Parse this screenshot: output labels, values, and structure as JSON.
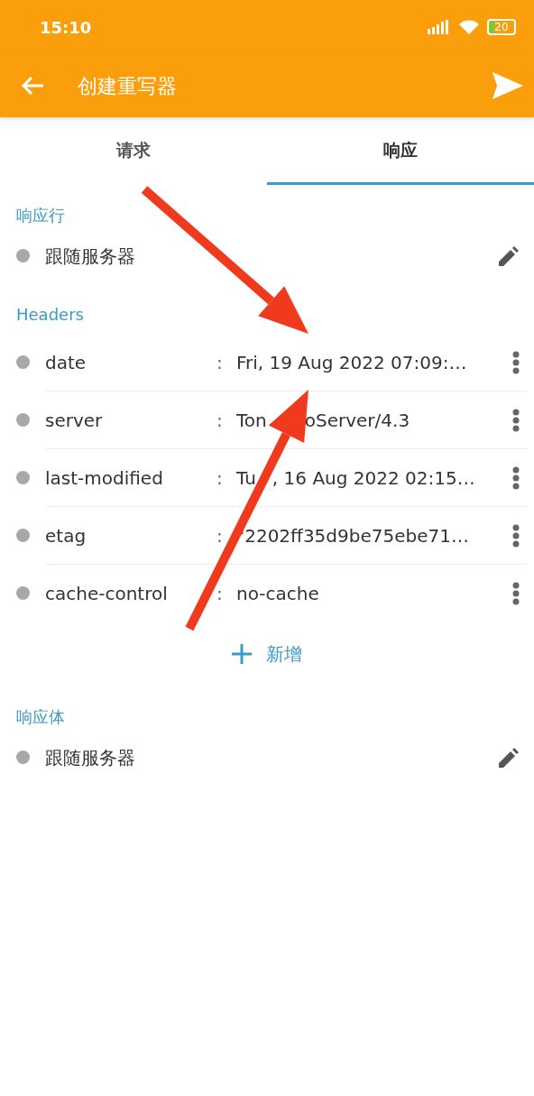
{
  "status_bar": {
    "time": "15:10",
    "battery": "20"
  },
  "app_bar": {
    "title": "创建重写器"
  },
  "tabs": [
    {
      "label": "请求",
      "selected": false
    },
    {
      "label": "响应",
      "selected": true
    }
  ],
  "response_line": {
    "title": "响应行",
    "value": "跟随服务器"
  },
  "headers": {
    "title": "Headers",
    "rows": [
      {
        "name": "date",
        "value_parts": [
          "Fri, 19 Aug 2022 07:09:…"
        ]
      },
      {
        "name": "server",
        "value_parts": [
          "Ton",
          "oServer/4.3"
        ]
      },
      {
        "name": "last-modified",
        "value_parts": [
          "Tu",
          ", 16 Aug 2022 02:15…"
        ]
      },
      {
        "name": "etag",
        "value_parts": [
          "\"2202ff35d9be75ebe71…"
        ]
      },
      {
        "name": "cache-control",
        "value_parts": [
          "no-cache"
        ]
      }
    ],
    "separator": ":",
    "add_label": "新增"
  },
  "response_body": {
    "title": "响应体",
    "value": "跟随服务器"
  },
  "overlay_arrows": [
    {
      "kind": "arrow"
    },
    {
      "kind": "arrow"
    }
  ]
}
